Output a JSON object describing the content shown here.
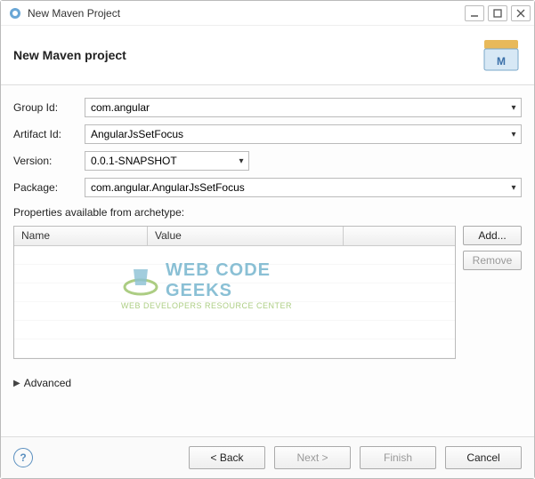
{
  "window": {
    "title": "New Maven Project"
  },
  "header": {
    "title": "New Maven project"
  },
  "form": {
    "group_id_label": "Group Id:",
    "group_id": "com.angular",
    "artifact_id_label": "Artifact Id:",
    "artifact_id": "AngularJsSetFocus",
    "version_label": "Version:",
    "version": "0.0.1-SNAPSHOT",
    "package_label": "Package:",
    "package": "com.angular.AngularJsSetFocus"
  },
  "properties": {
    "heading": "Properties available from archetype:",
    "columns": {
      "name": "Name",
      "value": "Value"
    },
    "add": "Add...",
    "remove": "Remove"
  },
  "advanced": {
    "label": "Advanced"
  },
  "footer": {
    "back": "< Back",
    "next": "Next >",
    "finish": "Finish",
    "cancel": "Cancel"
  },
  "watermark": {
    "line1": "WEB CODE GEEKS",
    "line2": "WEB DEVELOPERS RESOURCE CENTER"
  }
}
